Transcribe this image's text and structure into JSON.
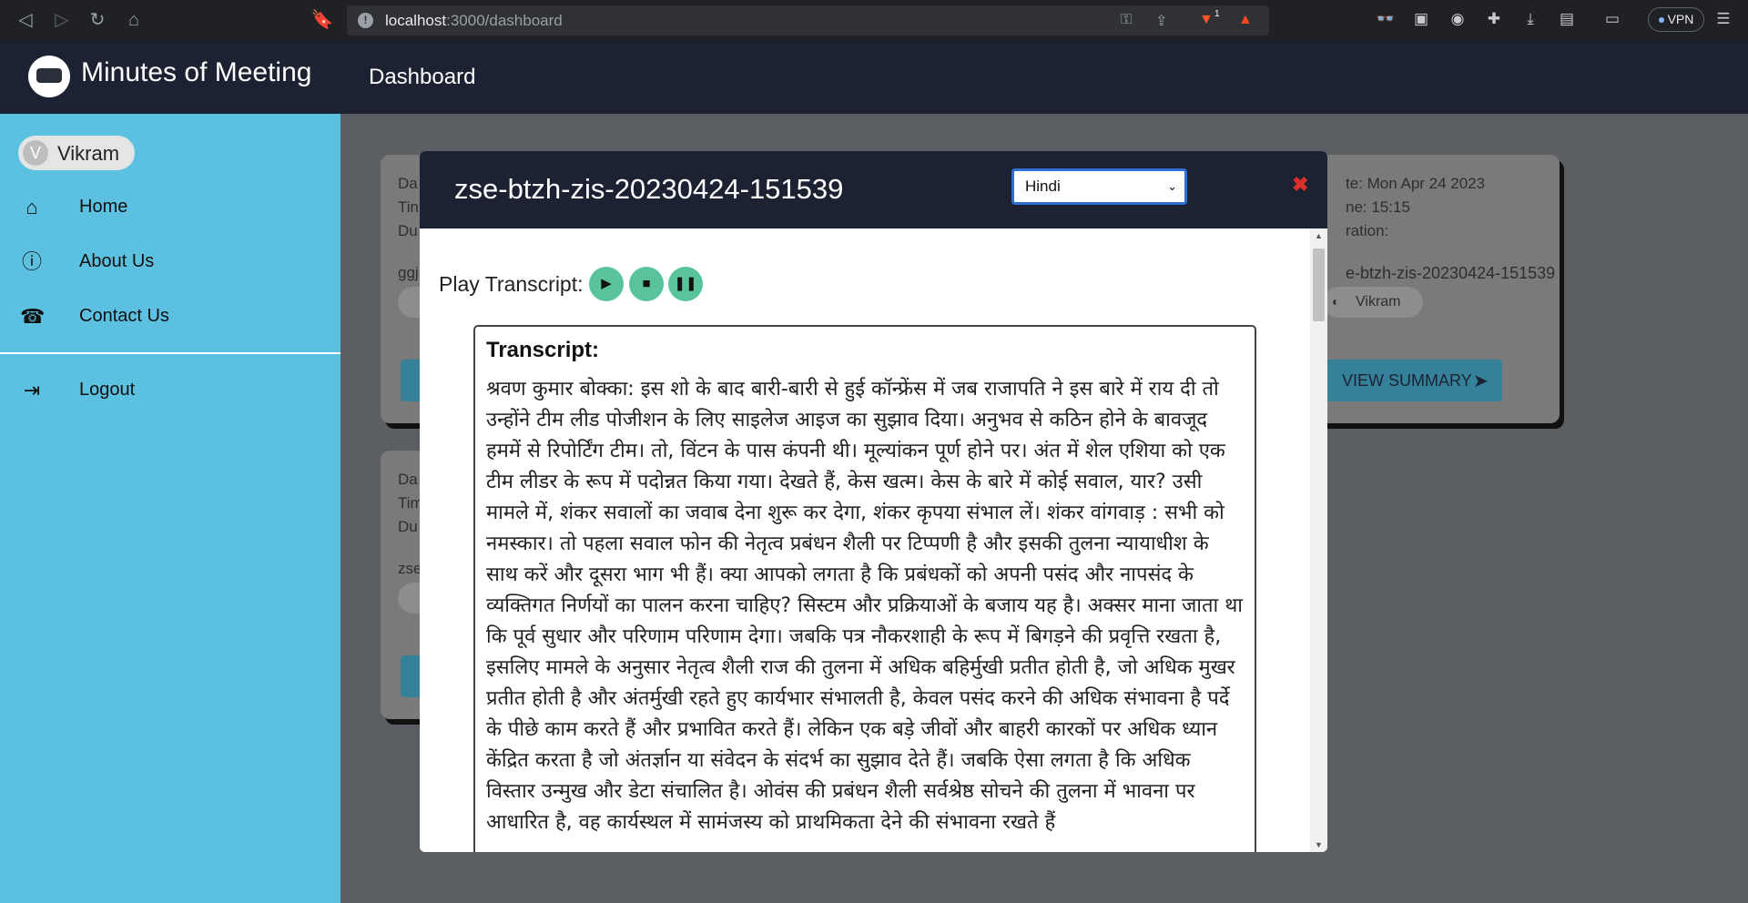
{
  "browser": {
    "url_host": "localhost",
    "url_path": ":3000/dashboard",
    "brave_badge": "1",
    "vpn_label": "VPN"
  },
  "sidebar": {
    "brand_title": "Minutes of Meeting",
    "user": {
      "initial": "V",
      "name": "Vikram"
    },
    "items": [
      {
        "label": "Home",
        "icon": "home-icon"
      },
      {
        "label": "About Us",
        "icon": "info-icon"
      },
      {
        "label": "Contact Us",
        "icon": "phone-icon"
      },
      {
        "label": "Logout",
        "icon": "logout-icon"
      }
    ]
  },
  "topbar": {
    "title": "Dashboard"
  },
  "cards": {
    "left_top": {
      "lines": [
        "Da",
        "Tin",
        "Du"
      ],
      "name": "ggj"
    },
    "left_bottom": {
      "lines": [
        "Da",
        "Tim",
        "Du"
      ],
      "name": "zse"
    },
    "right": {
      "date": "te: Mon Apr 24 2023",
      "time": "ne: 15:15",
      "duration": "ration:",
      "meeting_id": "e-btzh-zis-20230424-151539",
      "user": "Vikram",
      "button_label": "VIEW SUMMARY"
    }
  },
  "modal": {
    "title": "zse-btzh-zis-20230424-151539",
    "language_selected": "Hindi",
    "play_label": "Play Transcript:",
    "transcript_heading": "Transcript:",
    "transcript_text": "श्रवण कुमार बोक्का: इस शो के बाद बारी-बारी से हुई कॉन्फ्रेंस में जब राजापति ने इस बारे में राय दी तो उन्होंने टीम लीड पोजीशन के लिए साइलेज आइज का सुझाव दिया। अनुभव से कठिन होने के बावजूद हममें से रिपोर्टिंग टीम। तो, विंटन के पास कंपनी थी। मूल्यांकन पूर्ण होने पर। अंत में शेल एशिया को एक टीम लीडर के रूप में पदोन्नत किया गया। देखते हैं, केस खत्म। केस के बारे में कोई सवाल, यार? उसी मामले में, शंकर सवालों का जवाब देना शुरू कर देगा, शंकर कृपया संभाल लें। शंकर वांगवाड़ : सभी को नमस्कार। तो पहला सवाल फोन की नेतृत्व प्रबंधन शैली पर टिप्पणी है और इसकी तुलना न्यायाधीश के साथ करें और दूसरा भाग भी हैं। क्या आपको लगता है कि प्रबंधकों को अपनी पसंद और नापसंद के व्यक्तिगत निर्णयों का पालन करना चाहिए? सिस्टम और प्रक्रियाओं के बजाय यह है। अक्सर माना जाता था कि पूर्व सुधार और परिणाम परिणाम देगा। जबकि पत्र नौकरशाही के रूप में बिगड़ने की प्रवृत्ति रखता है, इसलिए मामले के अनुसार नेतृत्व शैली राज की तुलना में अधिक बहिर्मुखी प्रतीत होती है, जो अधिक मुखर प्रतीत होती है और अंतर्मुखी रहते हुए कार्यभार संभालती है, केवल पसंद करने की अधिक संभावना है पर्दे के पीछे काम करते हैं और प्रभावित करते हैं। लेकिन एक बड़े जीवों और बाहरी कारकों पर अधिक ध्यान केंद्रित करता है जो अंतर्ज्ञान या संवेदन के संदर्भ का सुझाव देते हैं। जबकि ऐसा लगता है कि अधिक विस्तार उन्मुख और डेटा संचालित है। ओवंस की प्रबंधन शैली सर्वश्रेष्ठ सोचने की तुलना में भावना पर आधारित है, वह कार्यस्थल में सामंजस्य को प्राथमिकता देने की संभावना रखते हैं"
  }
}
